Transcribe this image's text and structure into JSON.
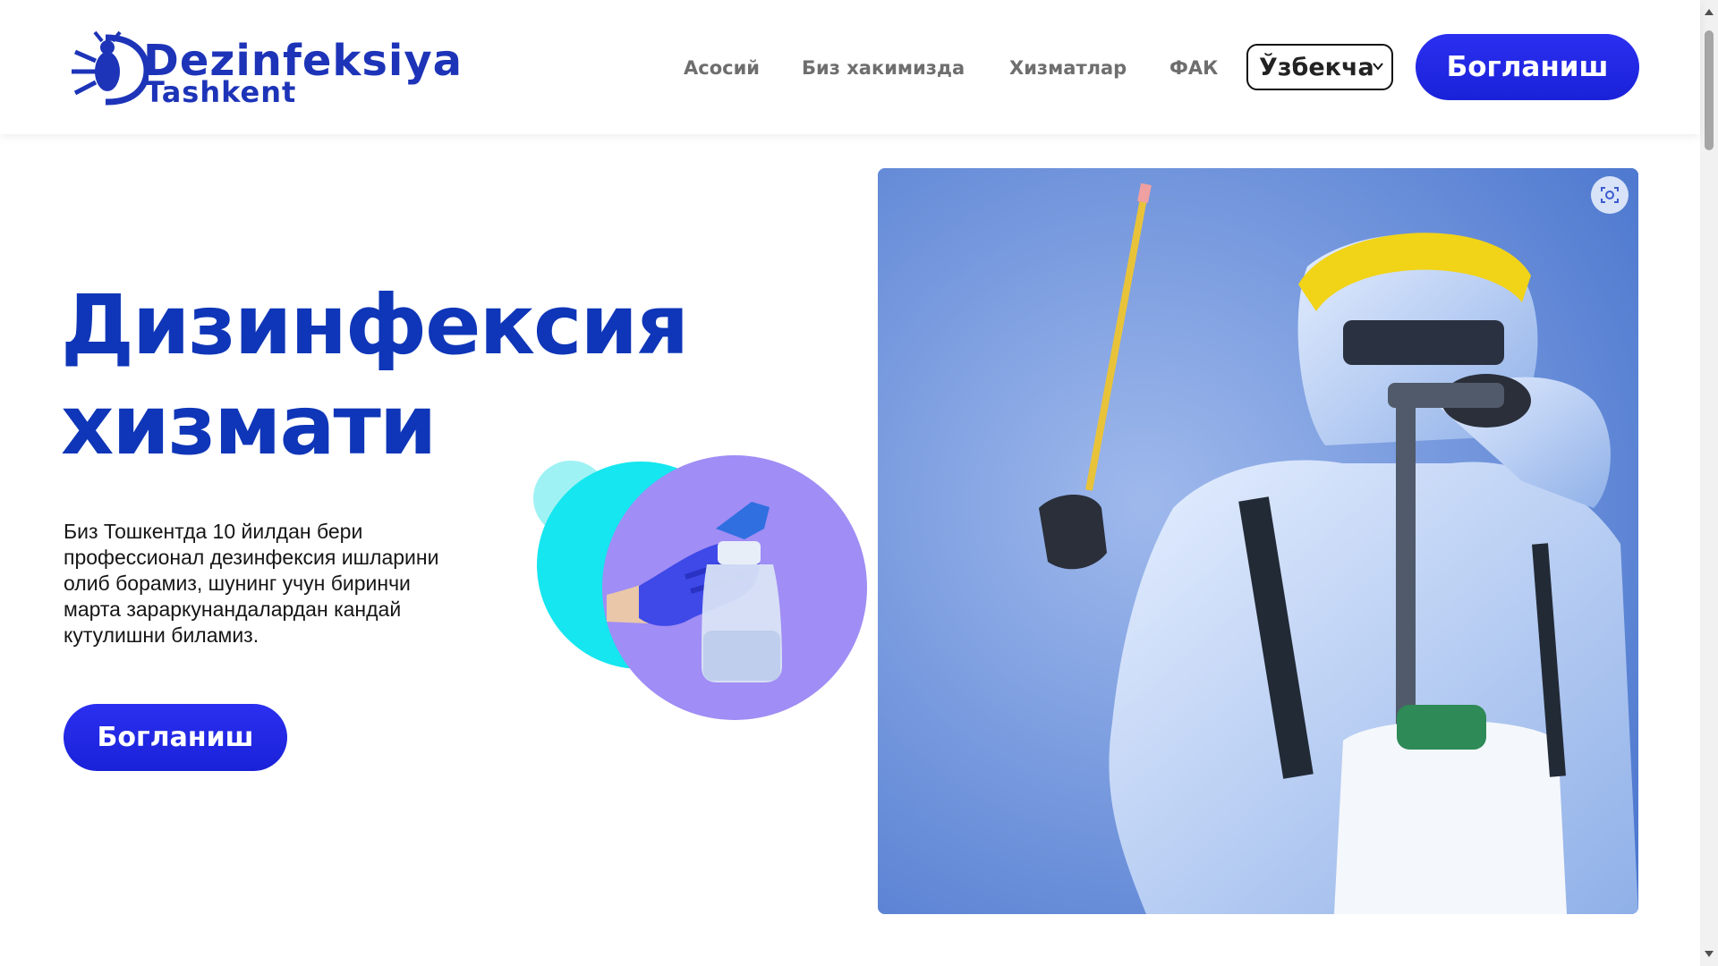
{
  "header": {
    "logo": {
      "line1": "Dezinfeksiya",
      "line2": "Tashkent",
      "icon": "bug-icon"
    },
    "nav": [
      {
        "label": "Асосий"
      },
      {
        "label": "Биз хакимизда"
      },
      {
        "label": "Хизматлар"
      },
      {
        "label": "ФАК"
      }
    ],
    "language": {
      "selected": "Ўзбекча"
    },
    "contact_button": "Богланиш"
  },
  "hero": {
    "title_line1": "Дизинфексия",
    "title_line2": "хизмати",
    "description": "Биз Тошкентда 10 йилдан бери профессионал дезинфексия ишларини олиб борамиз, шунинг учун биринчи марта зараркунандалардан кандай кутулишни биламиз.",
    "contact_button": "Богланиш"
  },
  "colors": {
    "brand_blue": "#0f36b8",
    "button_blue": "#2226e6",
    "nav_gray": "#6e6e6e"
  }
}
